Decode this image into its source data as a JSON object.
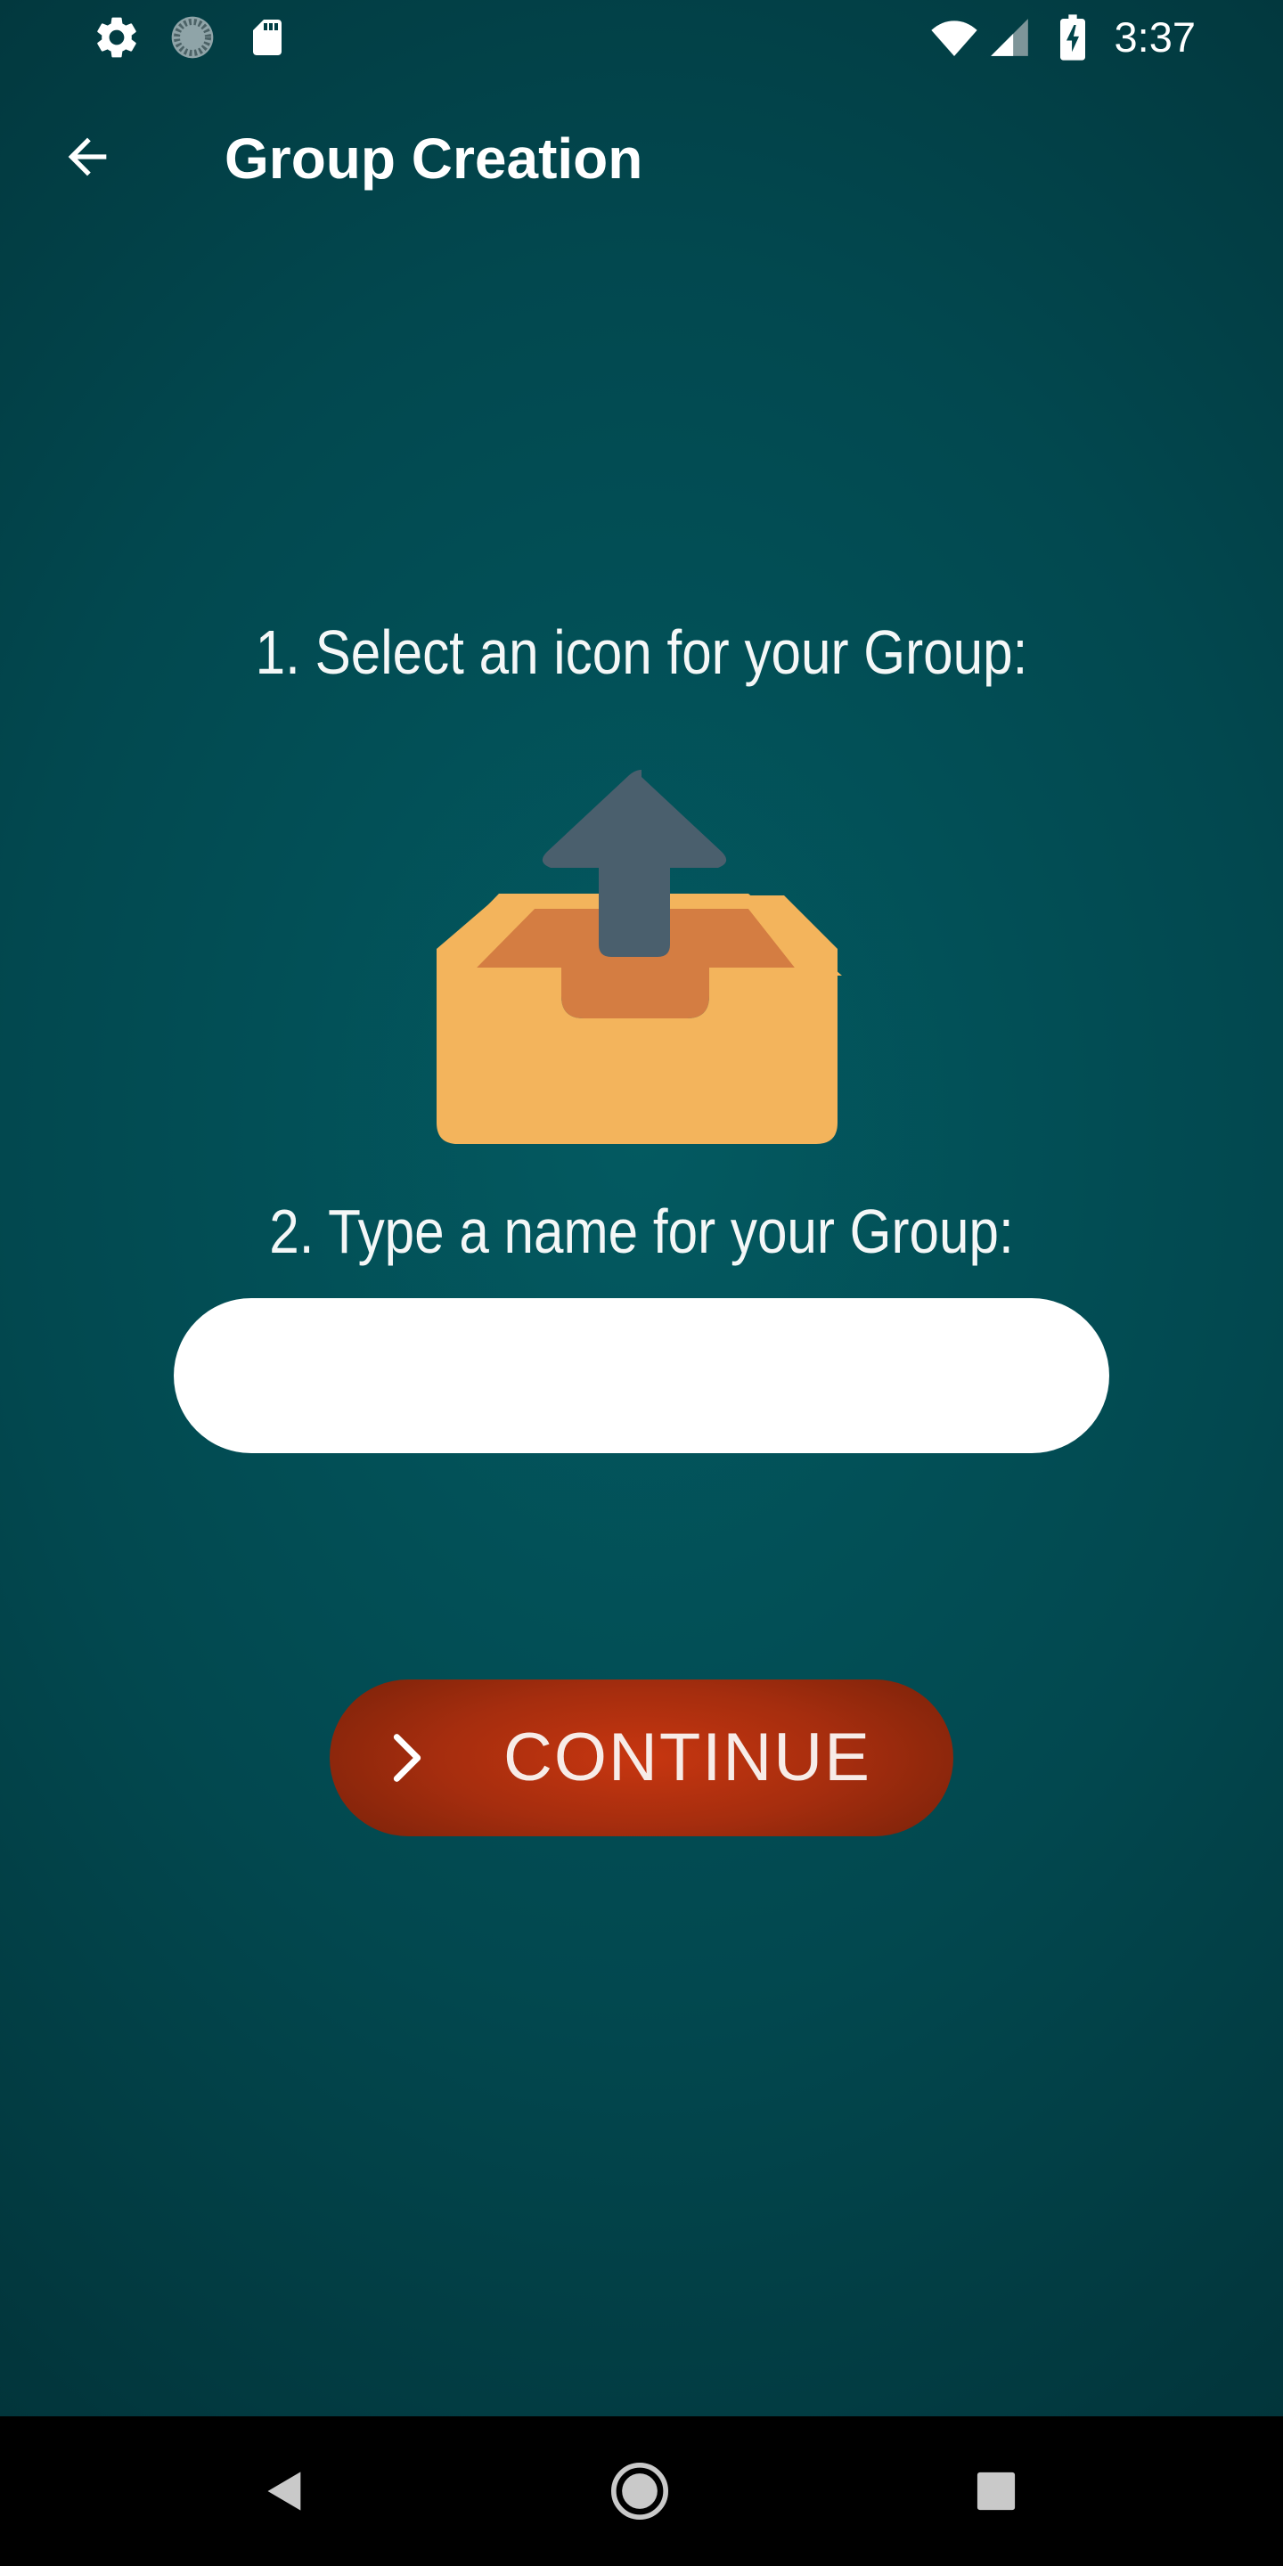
{
  "status_bar": {
    "time": "3:37",
    "left_icons": [
      "gear-icon",
      "sync-circle-icon",
      "sd-card-icon"
    ],
    "right_icons": [
      "wifi-icon",
      "cell-signal-icon",
      "battery-charging-icon"
    ]
  },
  "app_bar": {
    "back_icon": "arrow-back-icon",
    "title": "Group Creation"
  },
  "form": {
    "step1_label": "1. Select an icon for your Group:",
    "group_icon": "inbox-upload-icon",
    "step2_label": "2. Type a name for your Group:",
    "name_input": {
      "value": "",
      "placeholder": ""
    },
    "continue_label": "CONTINUE",
    "continue_icon": "chevron-right-icon"
  },
  "nav_bar": {
    "buttons": [
      "back-triangle-icon",
      "home-circle-icon",
      "recents-square-icon"
    ]
  },
  "colors": {
    "background": "#02484f",
    "button": "#b8310e",
    "box_body": "#f3b45c",
    "box_inner": "#d47d42",
    "arrow": "#4a5f6d"
  }
}
